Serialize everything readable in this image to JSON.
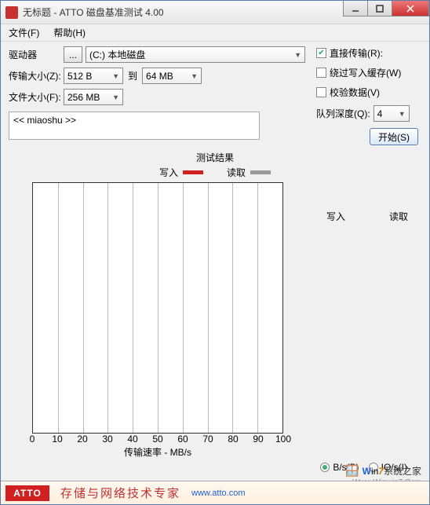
{
  "window": {
    "title": "无标题 - ATTO 磁盘基准测试 4.00"
  },
  "menu": {
    "file": "文件(F)",
    "help": "帮助(H)"
  },
  "labels": {
    "drive": "驱动器",
    "transfer_size": "传输大小(Z):",
    "to": "到",
    "file_size": "文件大小(F):",
    "queue_depth": "队列深度(Q):"
  },
  "values": {
    "drive": "(C:) 本地磁盘",
    "drive_btn": "...",
    "ts_from": "512 B",
    "ts_to": "64 MB",
    "file_size": "256 MB",
    "queue_depth": "4",
    "description": "<< miaoshu >>"
  },
  "options": {
    "direct_io": {
      "label": "直接传输(R):",
      "checked": true
    },
    "bypass_cache": {
      "label": "绕过写入缓存(W)",
      "checked": false
    },
    "verify_data": {
      "label": "校验数据(V)",
      "checked": false
    }
  },
  "buttons": {
    "start": "开始(S)"
  },
  "results": {
    "title": "测试结果",
    "write": "写入",
    "read": "读取",
    "col_write": "写入",
    "col_read": "读取"
  },
  "chart_data": {
    "type": "bar",
    "series": [
      {
        "name": "写入",
        "values": []
      },
      {
        "name": "读取",
        "values": []
      }
    ],
    "categories": [],
    "xlabel": "传输速率 - MB/s",
    "ylabel": "",
    "xlim": [
      0,
      100
    ],
    "xticks": [
      0,
      10,
      20,
      30,
      40,
      50,
      60,
      70,
      80,
      90,
      100
    ],
    "grid": true
  },
  "units": {
    "bs": "B/s(B)",
    "ios": "IO/s(I)",
    "selected": "bs"
  },
  "footer": {
    "logo": "ATTO",
    "tagline": "存储与网络技术专家",
    "url": "www.atto.com"
  },
  "watermark": {
    "brand_w": "W",
    "brand_in": "in",
    "brand_7": "7",
    "brand_rest": "系统之家",
    "url": "Www.Winwin7.Com"
  }
}
